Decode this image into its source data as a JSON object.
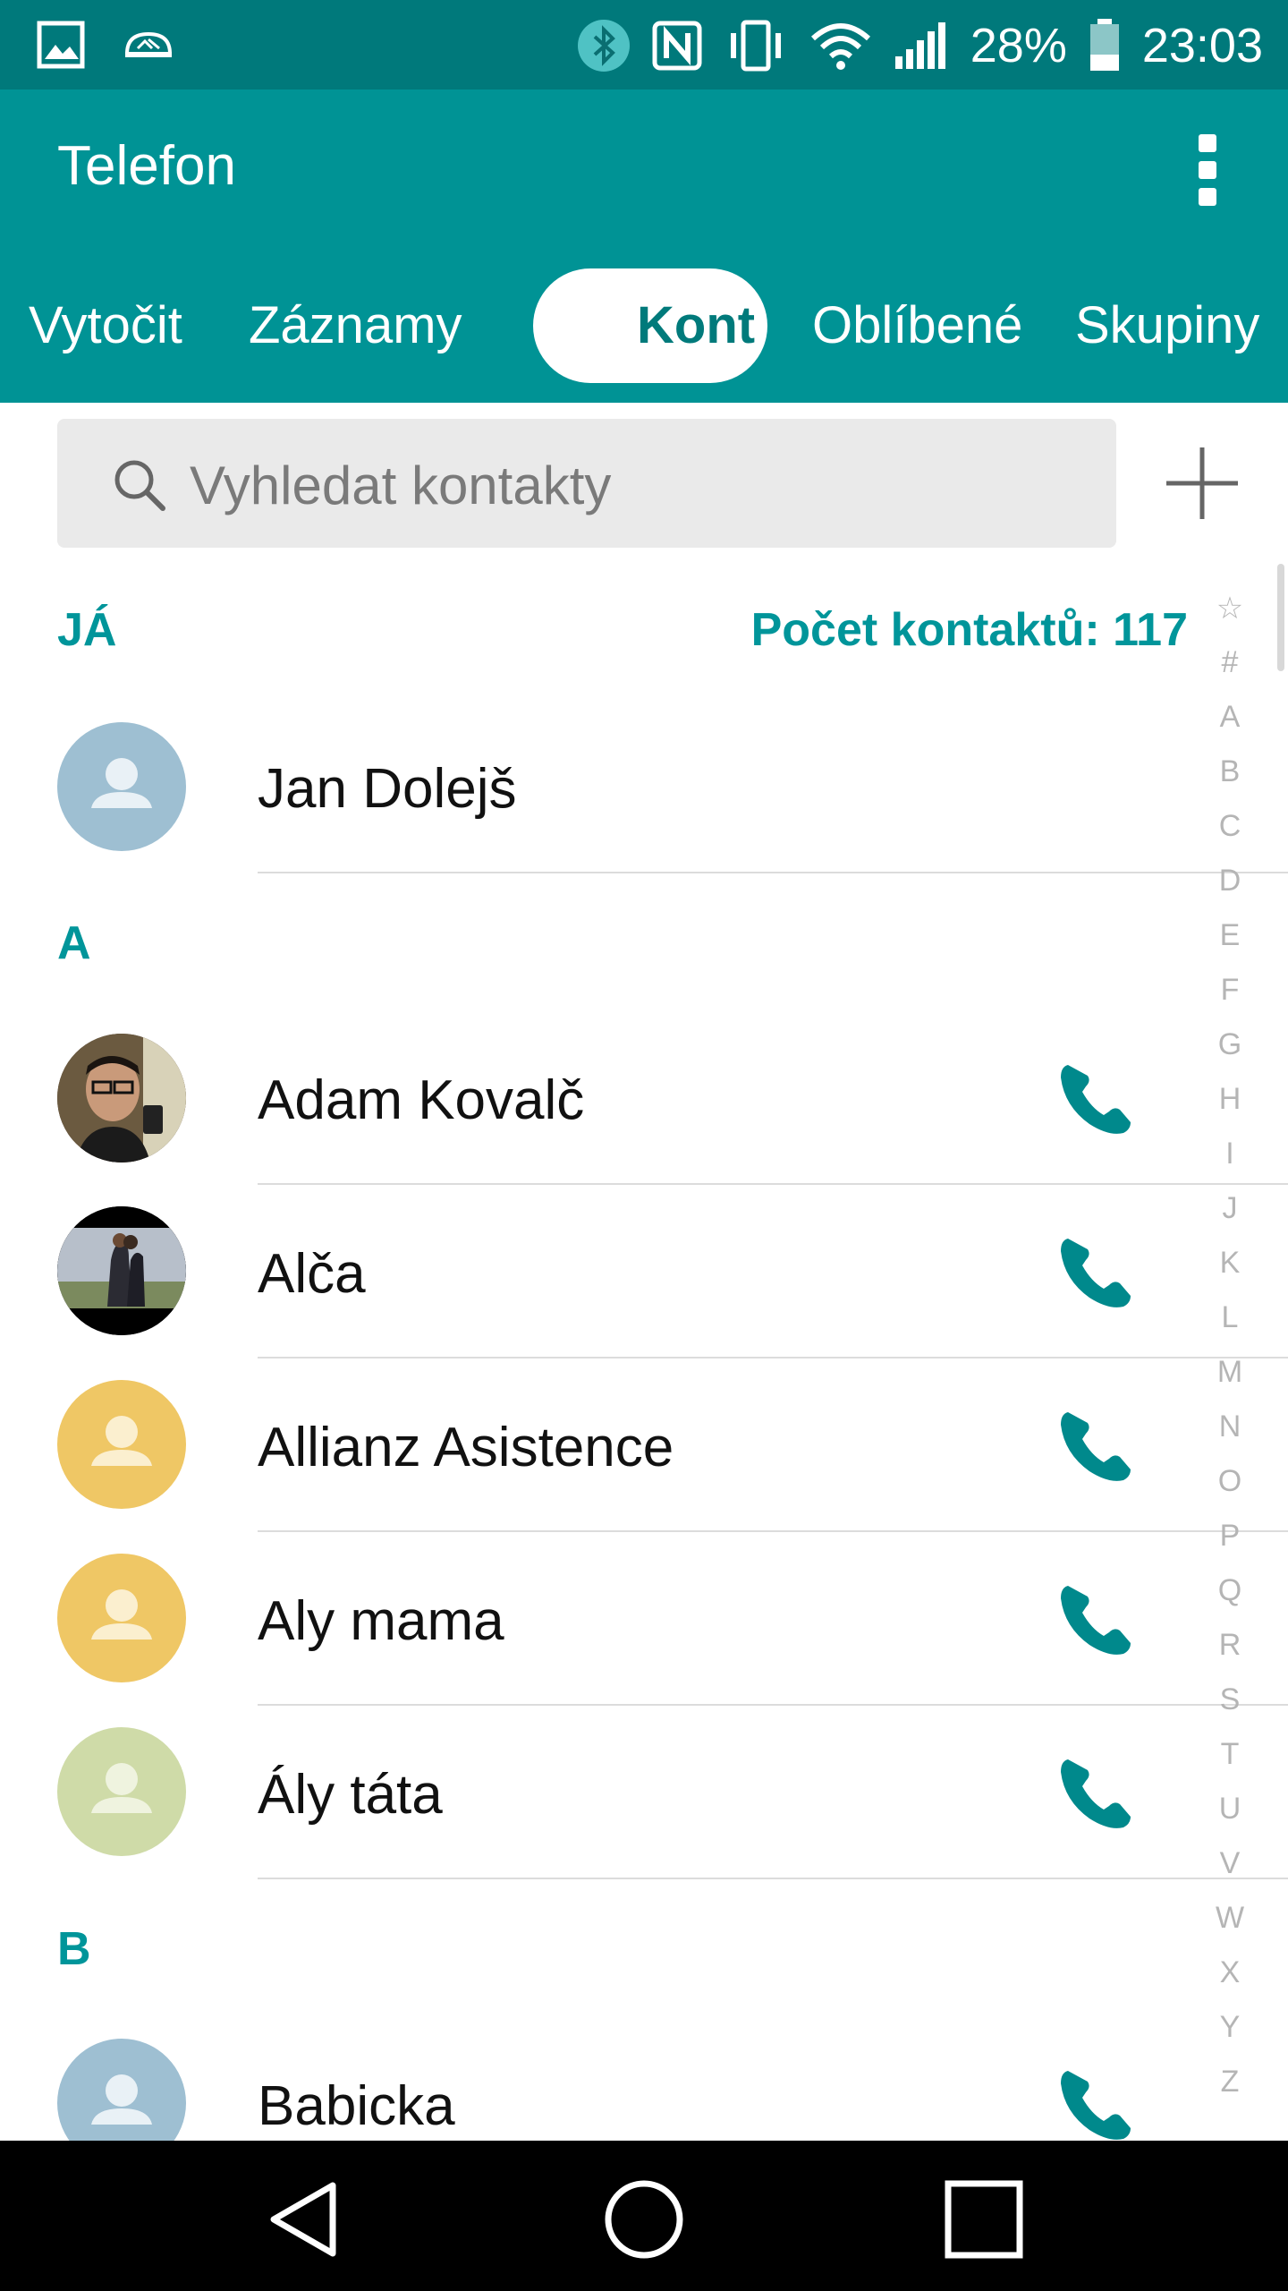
{
  "status_bar": {
    "battery_percent": "28%",
    "time": "23:03",
    "icons": [
      "gallery-icon",
      "cloud-icon",
      "bluetooth-icon",
      "nfc-icon",
      "vibrate-icon",
      "wifi-icon",
      "signal-icon",
      "battery-icon"
    ]
  },
  "app": {
    "title": "Telefon",
    "menu_icon": "more-vert-icon"
  },
  "tabs": [
    {
      "label": "Vytočit"
    },
    {
      "label": "Záznamy"
    },
    {
      "label": "Kontakty",
      "visible_text": "Kont",
      "active": true
    },
    {
      "label": "Oblíbené"
    },
    {
      "label": "Skupiny"
    }
  ],
  "search": {
    "placeholder": "Vyhledat kontakty",
    "value": ""
  },
  "me_section": {
    "header": "JÁ",
    "count_label": "Počet kontaktů: 117",
    "name": "Jan Dolejš"
  },
  "sections": [
    {
      "letter": "A",
      "contacts": [
        {
          "name": "Adam Kovalč",
          "avatar": "photo"
        },
        {
          "name": "Alča",
          "avatar": "photo"
        },
        {
          "name": "Allianz Asistence",
          "avatar": "placeholder",
          "color": "#efc765"
        },
        {
          "name": "Aly mama",
          "avatar": "placeholder",
          "color": "#efc765"
        },
        {
          "name": "Ály táta",
          "avatar": "placeholder",
          "color": "#cfdba8"
        }
      ]
    },
    {
      "letter": "B",
      "contacts": [
        {
          "name": "Babicka",
          "avatar": "placeholder",
          "color": "#9ebfd2"
        }
      ]
    }
  ],
  "index_letters": [
    "☆",
    "#",
    "A",
    "B",
    "C",
    "D",
    "E",
    "F",
    "G",
    "H",
    "I",
    "J",
    "K",
    "L",
    "M",
    "N",
    "O",
    "P",
    "Q",
    "R",
    "S",
    "T",
    "U",
    "V",
    "W",
    "X",
    "Y",
    "Z"
  ],
  "colors": {
    "status_bar": "#00797b",
    "app_bar": "#009395",
    "accent": "#00959a",
    "call_icon": "#00898c"
  },
  "nav": [
    "back-icon",
    "home-icon",
    "recents-icon"
  ]
}
